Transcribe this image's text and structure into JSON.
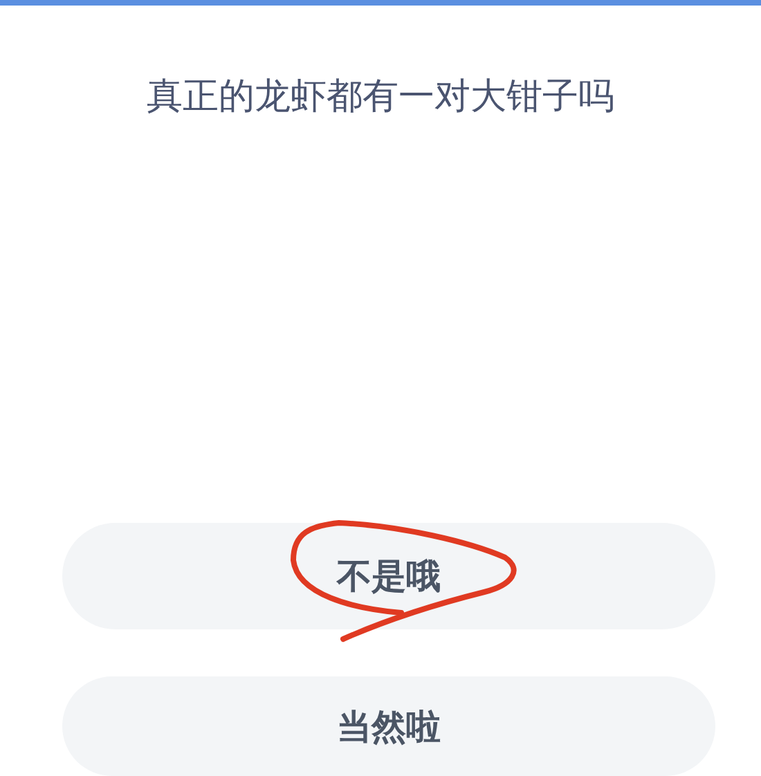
{
  "question": "真正的龙虾都有一对大钳子吗",
  "options": [
    {
      "label": "不是哦",
      "marked": true
    },
    {
      "label": "当然啦",
      "marked": false
    }
  ]
}
